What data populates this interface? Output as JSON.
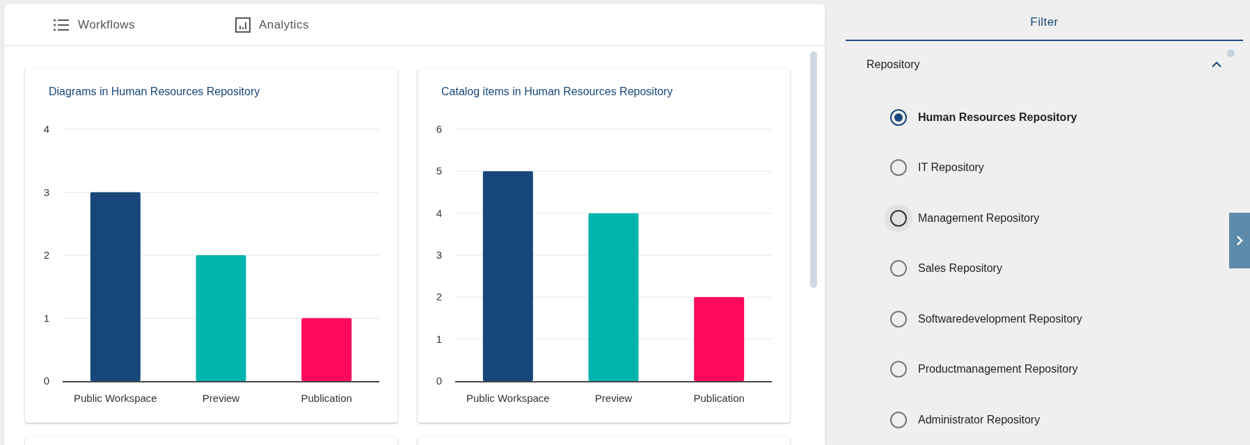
{
  "tabs": [
    {
      "label": "Workflows",
      "selected": false
    },
    {
      "label": "Analytics",
      "selected": false
    }
  ],
  "charts": [
    {
      "title": "Diagrams in Human Resources Repository",
      "chart_data": {
        "type": "bar",
        "grid": true,
        "series": [
          {
            "name": "Public Workspace",
            "color": "#17477a",
            "values": [
              3
            ]
          },
          {
            "name": "Preview",
            "color": "#00b4ae",
            "values": [
              2
            ]
          },
          {
            "name": "Publication",
            "color": "#ff0a5a",
            "values": [
              1
            ]
          }
        ],
        "ylim": [
          0,
          4
        ],
        "yticks": [
          0,
          1,
          2,
          3,
          4
        ]
      }
    },
    {
      "title": "Catalog items in Human Resources Repository",
      "chart_data": {
        "type": "bar",
        "grid": true,
        "series": [
          {
            "name": "Public Workspace",
            "color": "#17477a",
            "values": [
              5
            ]
          },
          {
            "name": "Preview",
            "color": "#00b4ae",
            "values": [
              4
            ]
          },
          {
            "name": "Publication",
            "color": "#ff0a5a",
            "values": [
              2
            ]
          }
        ],
        "ylim": [
          0,
          6
        ],
        "yticks": [
          0,
          1,
          2,
          3,
          4,
          5,
          6
        ]
      }
    }
  ],
  "filter": {
    "tab": "Filter",
    "section": {
      "title": "Repository",
      "expanded": true,
      "options": [
        {
          "label": "Human Resources Repository",
          "selected": true,
          "hovered": false
        },
        {
          "label": "IT Repository",
          "selected": false,
          "hovered": false
        },
        {
          "label": "Management Repository",
          "selected": false,
          "hovered": true
        },
        {
          "label": "Sales Repository",
          "selected": false,
          "hovered": false
        },
        {
          "label": "Softwaredevelopment Repository",
          "selected": false,
          "hovered": false
        },
        {
          "label": "Productmanagement Repository",
          "selected": false,
          "hovered": false
        },
        {
          "label": "Administrator Repository",
          "selected": false,
          "hovered": false
        }
      ]
    }
  }
}
